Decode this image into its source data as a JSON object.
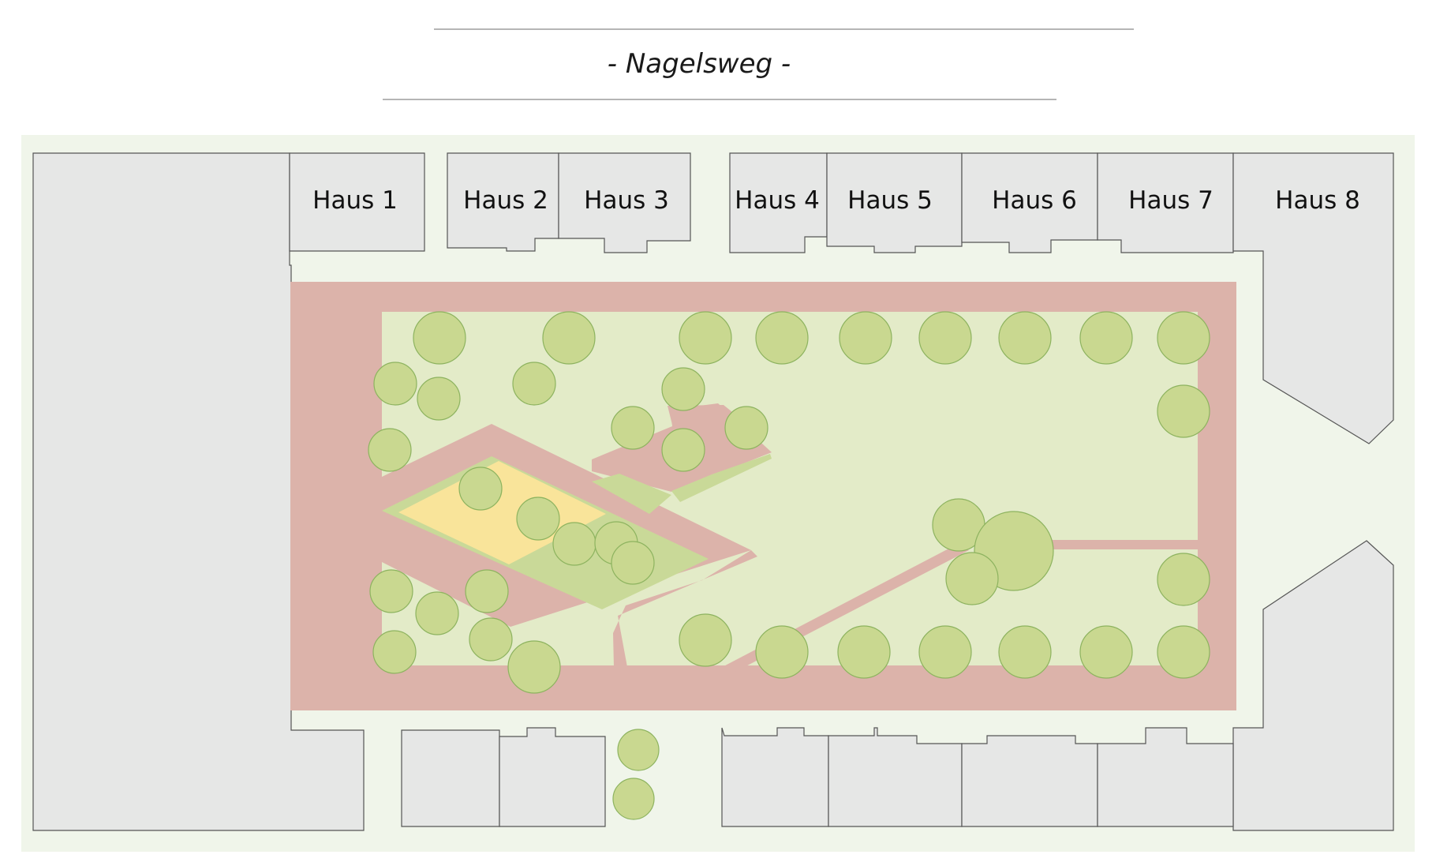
{
  "street": {
    "name": "- Nagelsweg -"
  },
  "houses": [
    {
      "label": "Haus 1"
    },
    {
      "label": "Haus 2"
    },
    {
      "label": "Haus 3"
    },
    {
      "label": "Haus 4"
    },
    {
      "label": "Haus 5"
    },
    {
      "label": "Haus 6"
    },
    {
      "label": "Haus 7"
    },
    {
      "label": "Haus 8"
    }
  ],
  "colors": {
    "site": "#f0f5ea",
    "building": "#e6e7e6",
    "path": "#dcb3aa",
    "lawn": "#e3ebc8",
    "planting": "#c9d998",
    "sandbox": "#f9e49a",
    "tree": "#c9d890",
    "lines": "#aaaaaa"
  },
  "icons": {
    "tree": "tree-icon",
    "building": "building-icon"
  }
}
